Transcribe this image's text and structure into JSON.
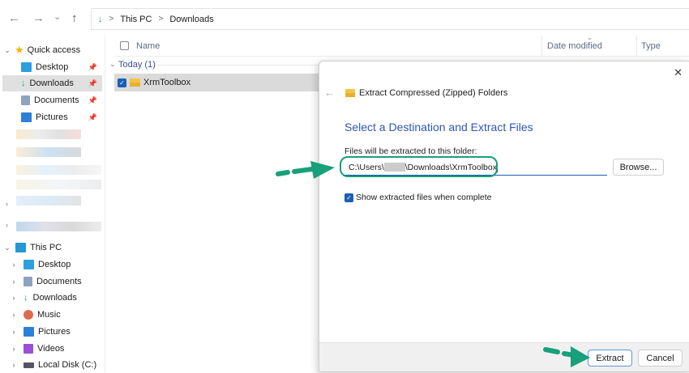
{
  "nav": {
    "back": "←",
    "forward": "→",
    "recent": "⌄",
    "up": "↑"
  },
  "address": {
    "crumbs": [
      "This PC",
      "Downloads"
    ],
    "separator": ">"
  },
  "sidebar": {
    "quick_access": {
      "label": "Quick access",
      "items": [
        {
          "label": "Desktop"
        },
        {
          "label": "Downloads"
        },
        {
          "label": "Documents"
        },
        {
          "label": "Pictures"
        }
      ]
    },
    "this_pc": {
      "label": "This PC",
      "items": [
        {
          "label": "Desktop"
        },
        {
          "label": "Documents"
        },
        {
          "label": "Downloads"
        },
        {
          "label": "Music"
        },
        {
          "label": "Pictures"
        },
        {
          "label": "Videos"
        },
        {
          "label": "Local Disk (C:)"
        }
      ]
    }
  },
  "list": {
    "columns": [
      "Name",
      "Date modified",
      "Type"
    ],
    "group": "Today (1)",
    "items": [
      {
        "name": "XrmToolbox"
      }
    ]
  },
  "dialog": {
    "title": "Extract Compressed (Zipped) Folders",
    "heading": "Select a Destination and Extract Files",
    "field_label": "Files will be extracted to this folder:",
    "path_prefix": "C:\\Users\\",
    "path_suffix": "\\Downloads\\XrmToolbox",
    "browse": "Browse...",
    "checkbox_label": "Show extracted files when complete",
    "extract": "Extract",
    "cancel": "Cancel",
    "close": "✕",
    "back": "←"
  },
  "colors": {
    "accent": "#1a5fb4",
    "heading": "#2e56b8",
    "annotation": "#17a07a"
  }
}
